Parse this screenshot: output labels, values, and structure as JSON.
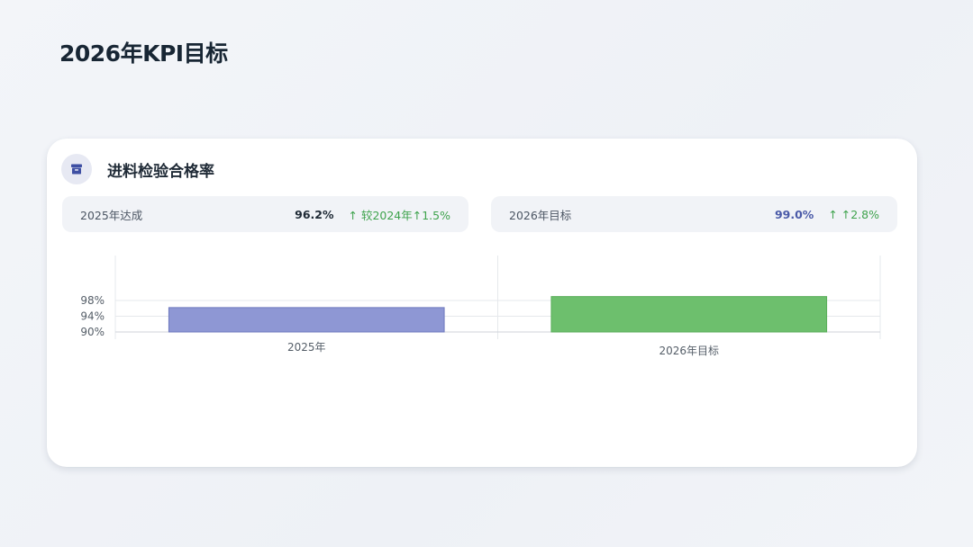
{
  "page": {
    "title": "2026年KPI目标"
  },
  "card": {
    "icon": "archive-box-icon",
    "title": "进料检验合格率",
    "stats": [
      {
        "label": "2025年达成",
        "value": "96.2%",
        "change": "↑ 较2024年↑1.5%"
      },
      {
        "label": "2026年目标",
        "value": "99.0%",
        "change": "↑ ↑2.8%"
      }
    ]
  },
  "colors": {
    "bar_2025": "#8e97d4",
    "bar_2026": "#6dbf6d",
    "accent_green": "#3fa34d",
    "accent_blue": "#4a5aa8"
  },
  "chart_data": {
    "type": "bar",
    "categories": [
      "2025年",
      "2026年目标"
    ],
    "values": [
      96.2,
      99.0
    ],
    "colors": [
      "#8e97d4",
      "#6dbf6d"
    ],
    "yticks": [
      "90%",
      "94%",
      "98%"
    ],
    "ytick_values": [
      90,
      94,
      98
    ],
    "ylim": [
      90,
      99
    ],
    "grid": true
  }
}
